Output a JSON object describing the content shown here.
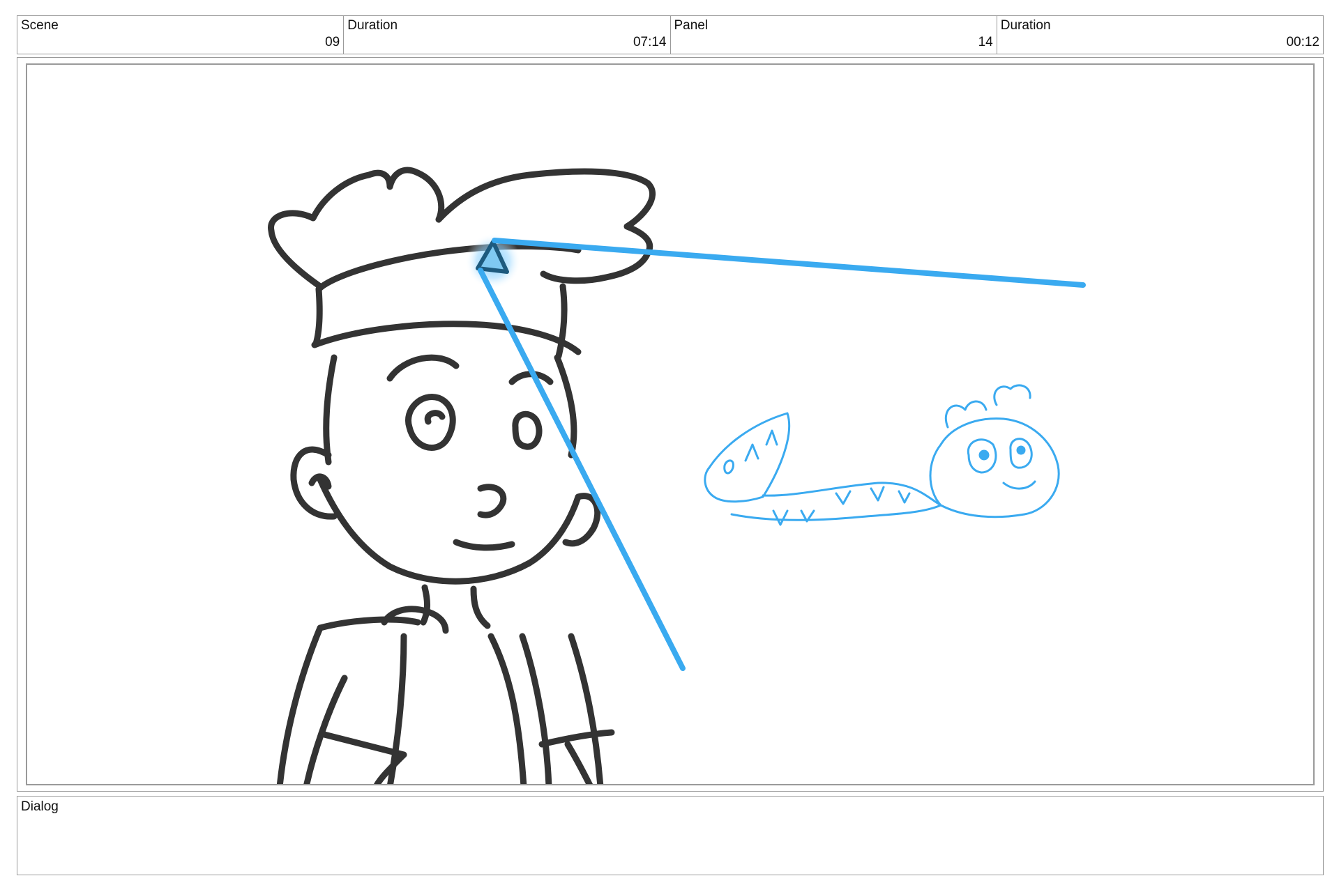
{
  "header": {
    "scene_label": "Scene",
    "scene_value": "09",
    "scene_duration_label": "Duration",
    "scene_duration_value": "07:14",
    "panel_label": "Panel",
    "panel_value": "14",
    "panel_duration_label": "Duration",
    "panel_duration_value": "00:12"
  },
  "dialog": {
    "label": "Dialog",
    "text": ""
  },
  "colors": {
    "sketch_dark": "#333333",
    "sketch_blue": "#3aaaf0",
    "border": "#9a9a9a"
  }
}
